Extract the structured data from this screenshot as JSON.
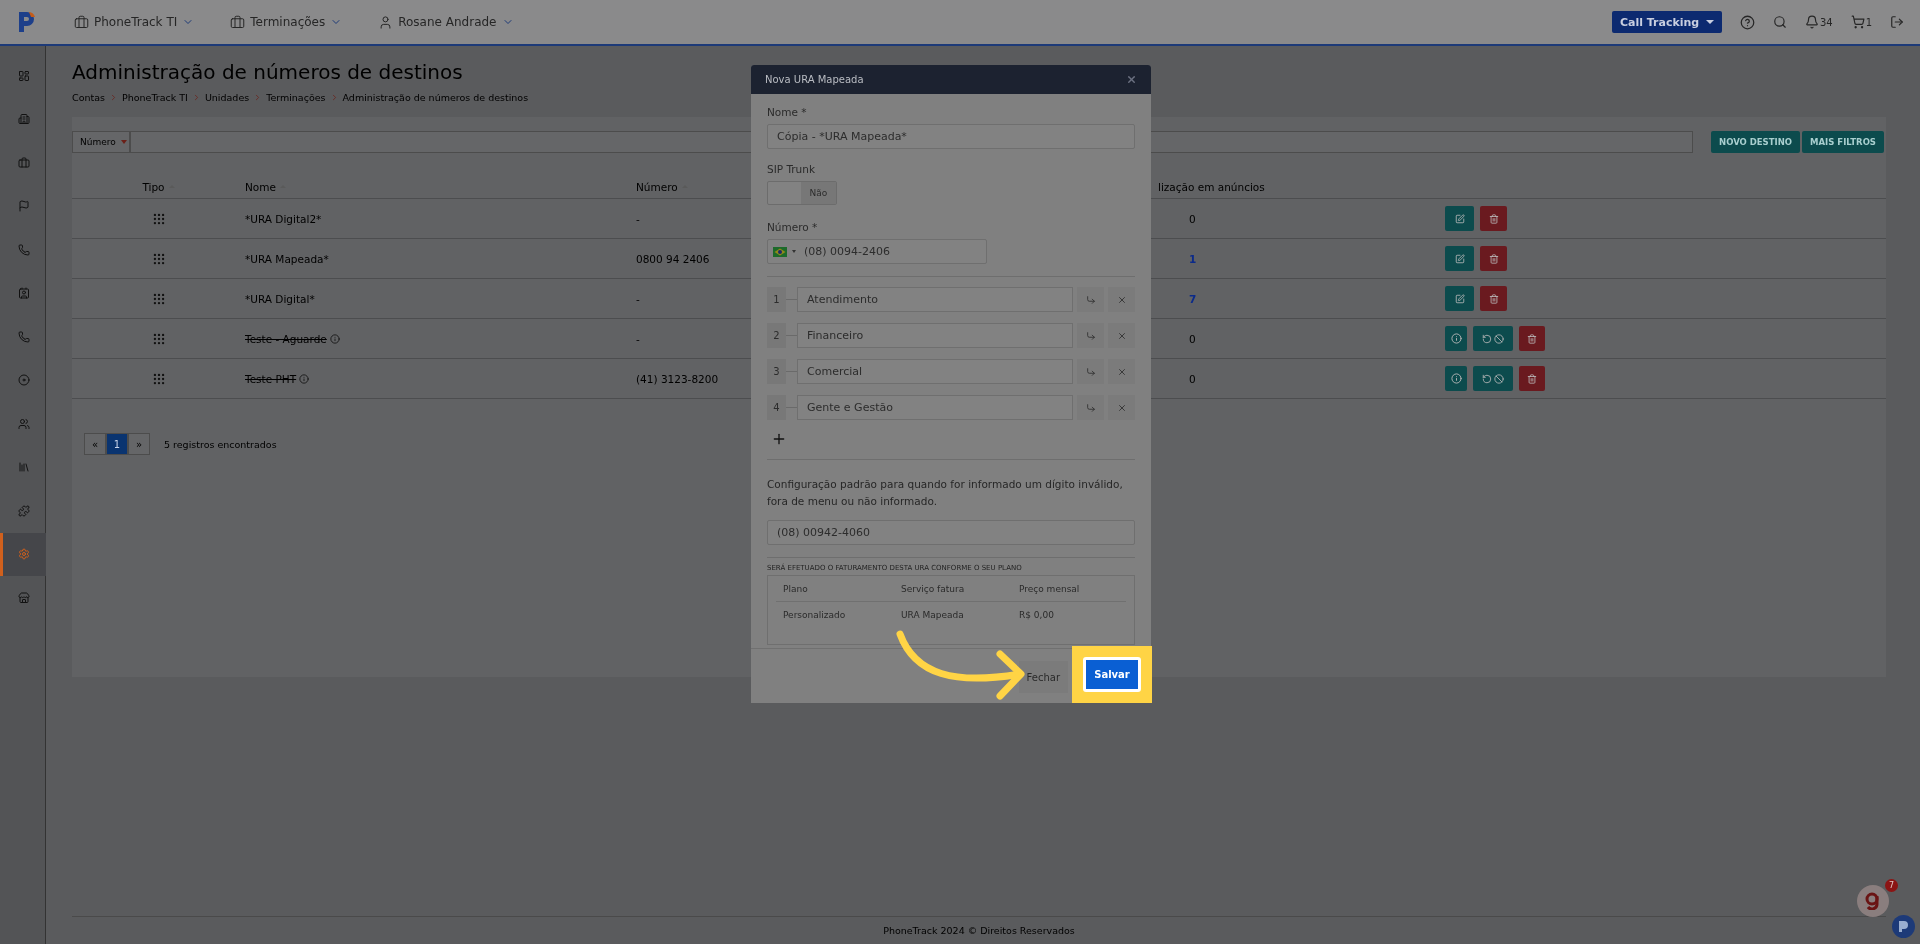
{
  "topbar": {
    "menus": [
      {
        "kind": "briefcase",
        "label": "PhoneTrack TI"
      },
      {
        "kind": "briefcase",
        "label": "Terminações"
      },
      {
        "kind": "user",
        "label": "Rosane Andrade"
      }
    ],
    "product_select": "Call Tracking",
    "notifications": "34",
    "cart": "1"
  },
  "sidebar": {
    "items": [
      {
        "kind": "dashboard",
        "selected": false
      },
      {
        "kind": "building",
        "selected": false
      },
      {
        "kind": "briefcase",
        "selected": false
      },
      {
        "kind": "flag",
        "selected": false
      },
      {
        "kind": "phone",
        "selected": false
      },
      {
        "kind": "card",
        "selected": false
      },
      {
        "kind": "phone",
        "selected": false
      },
      {
        "kind": "disc",
        "selected": false
      },
      {
        "kind": "users",
        "selected": false
      },
      {
        "kind": "library",
        "selected": false
      },
      {
        "kind": "puzzle",
        "selected": false
      },
      {
        "kind": "settings",
        "selected": true
      },
      {
        "kind": "store",
        "selected": false
      }
    ]
  },
  "page": {
    "title": "Administração de números de destinos",
    "breadcrumbs": [
      "Contas",
      "PhoneTrack TI",
      "Unidades",
      "Terminações",
      "Administração de números de destinos"
    ]
  },
  "filter": {
    "field": "Número",
    "buttons": [
      "NOVO DESTINO",
      "MAIS FILTROS"
    ]
  },
  "table": {
    "columns": [
      "Tipo",
      "Nome",
      "Número",
      "lização em anúncios"
    ],
    "rows": [
      {
        "name": "*URA Digital2*",
        "number": "-",
        "usage": "0",
        "usage_link": false,
        "disabled": false
      },
      {
        "name": "*URA Mapeada*",
        "number": "0800 94 2406",
        "usage": "1",
        "usage_link": true,
        "disabled": false
      },
      {
        "name": "*URA Digital*",
        "number": "-",
        "usage": "7",
        "usage_link": true,
        "disabled": false
      },
      {
        "name": "Teste - Aguarde",
        "number": "-",
        "usage": "0",
        "usage_link": false,
        "disabled": true
      },
      {
        "name": "Teste PHT",
        "number": "(41) 3123-8200",
        "usage": "0",
        "usage_link": false,
        "disabled": true
      }
    ]
  },
  "pagination": {
    "prev": "«",
    "next": "»",
    "pages": [
      {
        "label": "1",
        "selected": true
      }
    ],
    "summary": "5 registros encontrados"
  },
  "modal": {
    "title": "Nova URA Mapeada",
    "name_label": "Nome *",
    "name_value": "Cópia - *URA Mapeada*",
    "sip_label": "SIP Trunk",
    "sip": {
      "on": false,
      "label": "Não"
    },
    "number_label": "Número *",
    "number_value": "(08) 0094-2406",
    "options": [
      {
        "key": "1",
        "label": "Atendimento"
      },
      {
        "key": "2",
        "label": "Financeiro"
      },
      {
        "key": "3",
        "label": "Comercial"
      },
      {
        "key": "4",
        "label": "Gente e Gestão"
      }
    ],
    "default_text": "Configuração padrão para quando for informado um dígito inválido, fora de menu ou não informado.",
    "default_value": "(08) 00942-4060",
    "billing_caption": "SERÁ EFETUADO O FATURAMENTO DESTA URA CONFORME O SEU PLANO",
    "billing_columns": [
      "Plano",
      "Serviço fatura",
      "Preço mensal"
    ],
    "billing_row": [
      "Personalizado",
      "URA Mapeada",
      "R$ 0,00"
    ],
    "buttons": [
      "Fechar",
      "Salvar"
    ]
  },
  "footer": "PhoneTrack 2024 © Direitos Reservados",
  "widget": {
    "badge": "7"
  }
}
